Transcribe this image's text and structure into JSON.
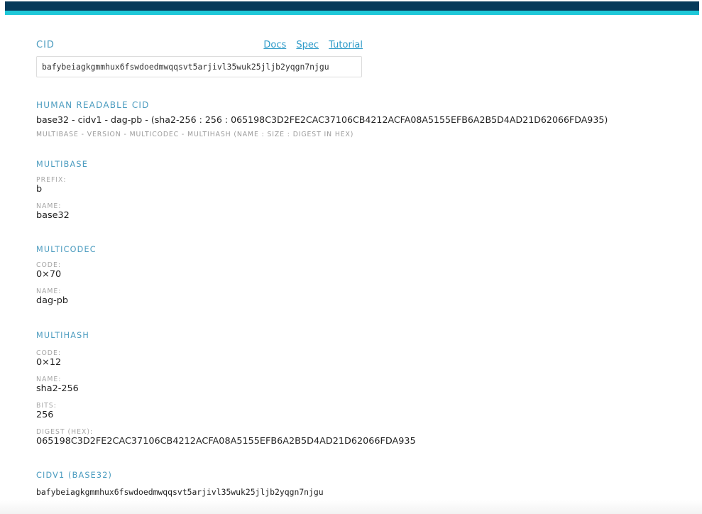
{
  "header": {
    "bar_color": "#063a5a",
    "accent_color": "#1ec8d8"
  },
  "cid": {
    "title": "CID",
    "links": [
      {
        "label": "Docs"
      },
      {
        "label": "Spec"
      },
      {
        "label": "Tutorial"
      }
    ],
    "input_value": "bafybeiagkgmmhux6fswdoedmwqqsvt5arjivl35wuk25jljb2yqgn7njgu"
  },
  "human_readable": {
    "title": "HUMAN READABLE CID",
    "value": "base32 - cidv1 - dag-pb - (sha2-256 : 256 : 065198C3D2FE2CAC37106CB4212ACFA08A5155EFB6A2B5D4AD21D62066FDA935)",
    "legend": "MULTIBASE - VERSION - MULTICODEC - MULTIHASH (NAME : SIZE : DIGEST IN HEX)"
  },
  "multibase": {
    "title": "MULTIBASE",
    "fields": [
      {
        "label": "PREFIX:",
        "value": "b"
      },
      {
        "label": "NAME:",
        "value": "base32"
      }
    ]
  },
  "multicodec": {
    "title": "MULTICODEC",
    "fields": [
      {
        "label": "CODE:",
        "value": "0×70"
      },
      {
        "label": "NAME:",
        "value": "dag-pb"
      }
    ]
  },
  "multihash": {
    "title": "MULTIHASH",
    "fields": [
      {
        "label": "CODE:",
        "value": "0×12"
      },
      {
        "label": "NAME:",
        "value": "sha2-256"
      },
      {
        "label": "BITS:",
        "value": "256"
      },
      {
        "label": "DIGEST (HEX):",
        "value": "065198C3D2FE2CAC37106CB4212ACFA08A5155EFB6A2B5D4AD21D62066FDA935"
      }
    ]
  },
  "cidv1": {
    "title": "CIDV1 (BASE32)",
    "value": "bafybeiagkgmmhux6fswdoedmwqqsvt5arjivl35wuk25jljb2yqgn7njgu"
  }
}
